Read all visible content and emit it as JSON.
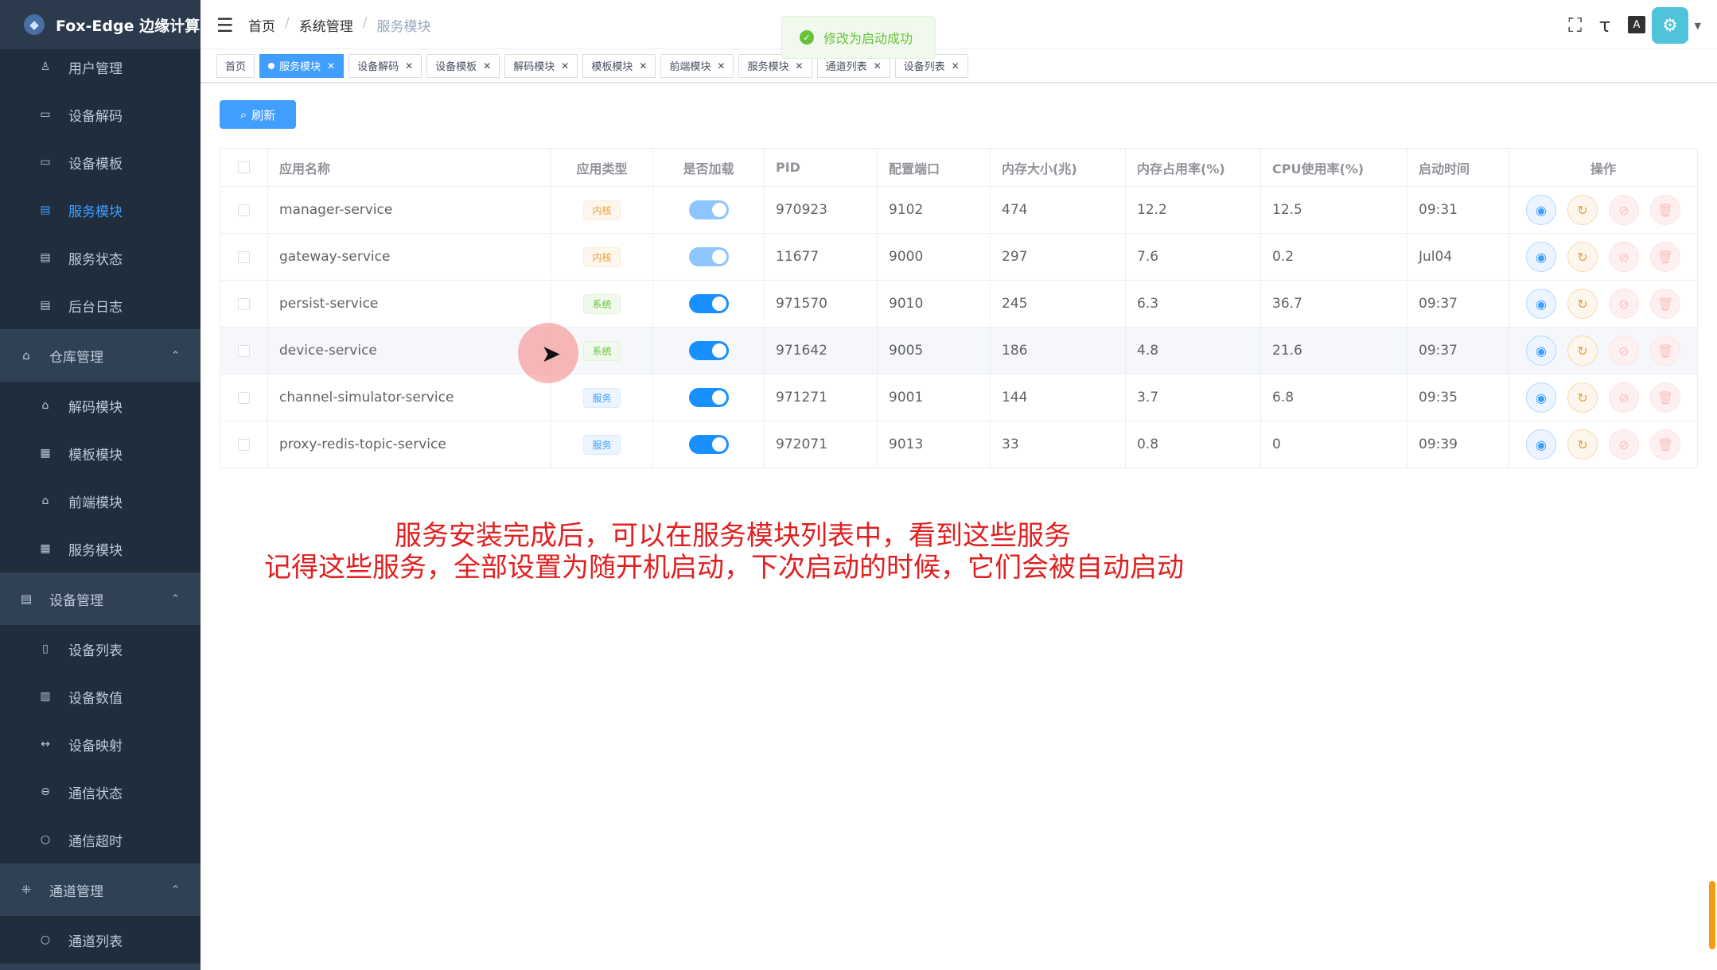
{
  "app": {
    "title": "Fox-Edge 边缘计算"
  },
  "sidebar": {
    "items": [
      {
        "label": "用户管理",
        "icon": "user-icon",
        "glyph": "♙",
        "type": "item"
      },
      {
        "label": "设备解码",
        "icon": "keyboard-icon",
        "glyph": "▭",
        "type": "item"
      },
      {
        "label": "设备模板",
        "icon": "keyboard-icon",
        "glyph": "▭",
        "type": "item"
      },
      {
        "label": "服务模块",
        "icon": "document-icon",
        "glyph": "▤",
        "type": "item",
        "active": true
      },
      {
        "label": "服务状态",
        "icon": "document-icon",
        "glyph": "▤",
        "type": "item"
      },
      {
        "label": "后台日志",
        "icon": "document-icon",
        "glyph": "▤",
        "type": "item"
      },
      {
        "label": "仓库管理",
        "icon": "home-icon",
        "glyph": "⌂",
        "type": "group"
      },
      {
        "label": "解码模块",
        "icon": "home-icon",
        "glyph": "⌂",
        "type": "item"
      },
      {
        "label": "模板模块",
        "icon": "form-icon",
        "glyph": "▦",
        "type": "item"
      },
      {
        "label": "前端模块",
        "icon": "home-icon",
        "glyph": "⌂",
        "type": "item"
      },
      {
        "label": "服务模块",
        "icon": "form-icon",
        "glyph": "▦",
        "type": "item"
      },
      {
        "label": "设备管理",
        "icon": "server-icon",
        "glyph": "▤",
        "type": "group"
      },
      {
        "label": "设备列表",
        "icon": "device-icon",
        "glyph": "▯",
        "type": "item"
      },
      {
        "label": "设备数值",
        "icon": "database-icon",
        "glyph": "▥",
        "type": "item"
      },
      {
        "label": "设备映射",
        "icon": "mapping-icon",
        "glyph": "↔",
        "type": "item"
      },
      {
        "label": "通信状态",
        "icon": "status-icon",
        "glyph": "⊖",
        "type": "item"
      },
      {
        "label": "通信超时",
        "icon": "clock-icon",
        "glyph": "○",
        "type": "item"
      },
      {
        "label": "通道管理",
        "icon": "channel-icon",
        "glyph": "⁜",
        "type": "group"
      },
      {
        "label": "通道列表",
        "icon": "clock-icon",
        "glyph": "○",
        "type": "item"
      }
    ]
  },
  "breadcrumb": [
    "首页",
    "系统管理",
    "服务模块"
  ],
  "toast": {
    "text": "修改为启动成功"
  },
  "tags": [
    {
      "label": "首页",
      "active": false,
      "closable": false
    },
    {
      "label": "服务模块",
      "active": true,
      "closable": true
    },
    {
      "label": "设备解码",
      "active": false,
      "closable": true
    },
    {
      "label": "设备模板",
      "active": false,
      "closable": true
    },
    {
      "label": "解码模块",
      "active": false,
      "closable": true
    },
    {
      "label": "模板模块",
      "active": false,
      "closable": true
    },
    {
      "label": "前端模块",
      "active": false,
      "closable": true
    },
    {
      "label": "服务模块",
      "active": false,
      "closable": true
    },
    {
      "label": "通道列表",
      "active": false,
      "closable": true
    },
    {
      "label": "设备列表",
      "active": false,
      "closable": true
    }
  ],
  "toolbar": {
    "refresh_label": "刷新"
  },
  "table": {
    "headers": [
      "应用名称",
      "应用类型",
      "是否加载",
      "PID",
      "配置端口",
      "内存大小(兆)",
      "内存占用率(%)",
      "CPU使用率(%)",
      "启动时间",
      "操作"
    ],
    "rows": [
      {
        "name": "manager-service",
        "type": "内核",
        "type_kind": "kernel",
        "loaded": true,
        "switch_dim": true,
        "pid": "970923",
        "port": "9102",
        "mem": "474",
        "mem_rate": "12.2",
        "cpu": "12.5",
        "start": "09:31"
      },
      {
        "name": "gateway-service",
        "type": "内核",
        "type_kind": "kernel",
        "loaded": true,
        "switch_dim": true,
        "pid": "11677",
        "port": "9000",
        "mem": "297",
        "mem_rate": "7.6",
        "cpu": "0.2",
        "start": "Jul04"
      },
      {
        "name": "persist-service",
        "type": "系统",
        "type_kind": "system",
        "loaded": true,
        "switch_dim": false,
        "pid": "971570",
        "port": "9010",
        "mem": "245",
        "mem_rate": "6.3",
        "cpu": "36.7",
        "start": "09:37"
      },
      {
        "name": "device-service",
        "type": "系统",
        "type_kind": "system",
        "loaded": true,
        "switch_dim": false,
        "pid": "971642",
        "port": "9005",
        "mem": "186",
        "mem_rate": "4.8",
        "cpu": "21.6",
        "start": "09:37"
      },
      {
        "name": "channel-simulator-service",
        "type": "服务",
        "type_kind": "service",
        "loaded": true,
        "switch_dim": false,
        "pid": "971271",
        "port": "9001",
        "mem": "144",
        "mem_rate": "3.7",
        "cpu": "6.8",
        "start": "09:35"
      },
      {
        "name": "proxy-redis-topic-service",
        "type": "服务",
        "type_kind": "service",
        "loaded": true,
        "switch_dim": false,
        "pid": "972071",
        "port": "9013",
        "mem": "33",
        "mem_rate": "0.8",
        "cpu": "0",
        "start": "09:39"
      }
    ]
  },
  "subtitles": [
    "服务安装完成后，可以在服务模块列表中，看到这些服务",
    "记得这些服务，全部设置为随开机启动，下次启动的时候，它们会被自动启动"
  ]
}
